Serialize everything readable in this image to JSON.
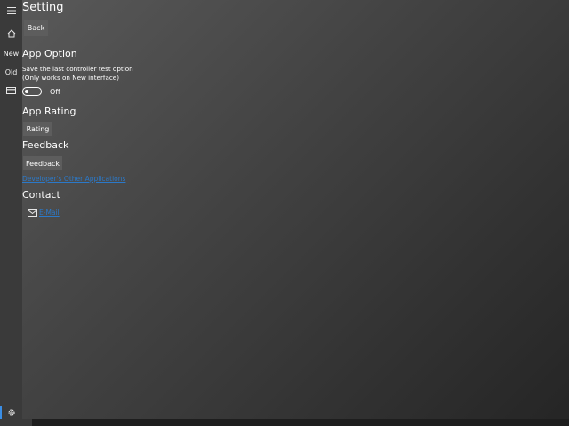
{
  "nav": {
    "items": [
      {
        "name": "hamburger-icon",
        "icon": "hamburger-icon"
      },
      {
        "name": "home-icon",
        "icon": "home-icon"
      },
      {
        "name": "nav-item-new",
        "label": "New"
      },
      {
        "name": "nav-item-old",
        "label": "Old"
      },
      {
        "name": "card-icon",
        "icon": "card-icon"
      },
      {
        "name": "settings-icon",
        "icon": "gear-icon"
      }
    ],
    "new_label": "New",
    "old_label": "Old",
    "active_accent": "#3a8ee6"
  },
  "page": {
    "title": "Setting",
    "back_label": "Back"
  },
  "app_option": {
    "heading": "App Option",
    "description_line1": "Save the last controller test option",
    "description_line2": "(Only works on New interface)",
    "toggle_state": "Off",
    "toggle_on": false
  },
  "app_rating": {
    "heading": "App Rating",
    "button_label": "Rating"
  },
  "feedback": {
    "heading": "Feedback",
    "button_label": "Feedback",
    "link_text": "Developer's Other Applications"
  },
  "contact": {
    "heading": "Contact",
    "email_label": "E-Mail",
    "email_icon": "mail-icon"
  },
  "colors": {
    "link": "#2b79c9",
    "button_bg": "#5d5d5d",
    "rail_bg": "#3a3a3a"
  }
}
